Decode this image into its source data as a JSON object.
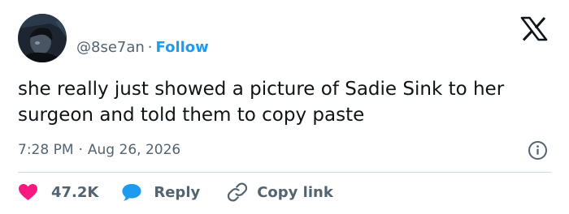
{
  "author": {
    "handle": "@8se7an",
    "separator": "·",
    "follow_label": "Follow"
  },
  "tweet": {
    "text": "she really just showed a picture of Sadie Sink to her surgeon and told them to copy paste",
    "time": "7:28 PM",
    "meta_separator": "·",
    "date": "Aug 26, 2026"
  },
  "actions": {
    "like_count": "47.2K",
    "reply_label": "Reply",
    "copy_link_label": "Copy link"
  },
  "icons": {
    "brand": "x-logo-icon",
    "info": "info-icon",
    "like": "heart-icon",
    "reply": "speech-bubble-icon",
    "copy": "link-icon"
  },
  "colors": {
    "text": "#0f1419",
    "secondary": "#536471",
    "accent": "#1d9bf0",
    "like": "#f91880",
    "divider": "#cfd9de"
  }
}
